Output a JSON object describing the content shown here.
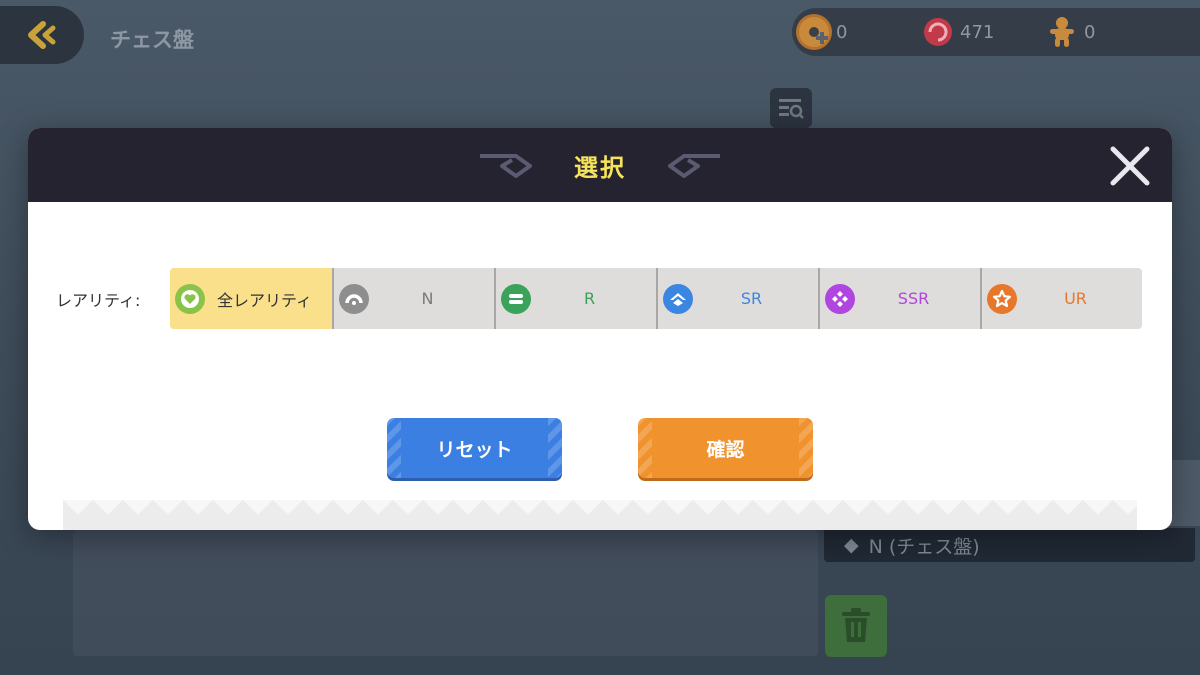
{
  "page": {
    "title": "チェス盤",
    "tag_text": "N (チェス盤)"
  },
  "currencies": [
    {
      "icon": "donut-plus-icon",
      "value": "0"
    },
    {
      "icon": "candy-icon",
      "value": "471"
    },
    {
      "icon": "gingerbread-icon",
      "value": "0"
    }
  ],
  "modal": {
    "title": "選択",
    "rarity_label": "レアリティ:",
    "rarity_options": [
      {
        "label": "全レアリティ",
        "icon": "heart-icon",
        "color": "#333333",
        "icon_bg": "#8bc34a",
        "selected": true
      },
      {
        "label": "N",
        "icon": "rarity-n-icon",
        "color": "#7a7a7a",
        "icon_bg": "#8e8e8e",
        "selected": false
      },
      {
        "label": "R",
        "icon": "rarity-r-icon",
        "color": "#3aa25a",
        "icon_bg": "#3aa25a",
        "selected": false
      },
      {
        "label": "SR",
        "icon": "rarity-sr-icon",
        "color": "#3b86e0",
        "icon_bg": "#3b86e0",
        "selected": false
      },
      {
        "label": "SSR",
        "icon": "rarity-ssr-icon",
        "color": "#b045e0",
        "icon_bg": "#b045e0",
        "selected": false
      },
      {
        "label": "UR",
        "icon": "rarity-ur-icon",
        "color": "#e7782a",
        "icon_bg": "#e7782a",
        "selected": false
      }
    ],
    "reset_label": "リセット",
    "confirm_label": "確認"
  },
  "colors": {
    "modal_title": "#f5e35c",
    "selected_bg": "#fae08a",
    "reset_btn": "#3b7fe3",
    "confirm_btn": "#f0922d"
  }
}
